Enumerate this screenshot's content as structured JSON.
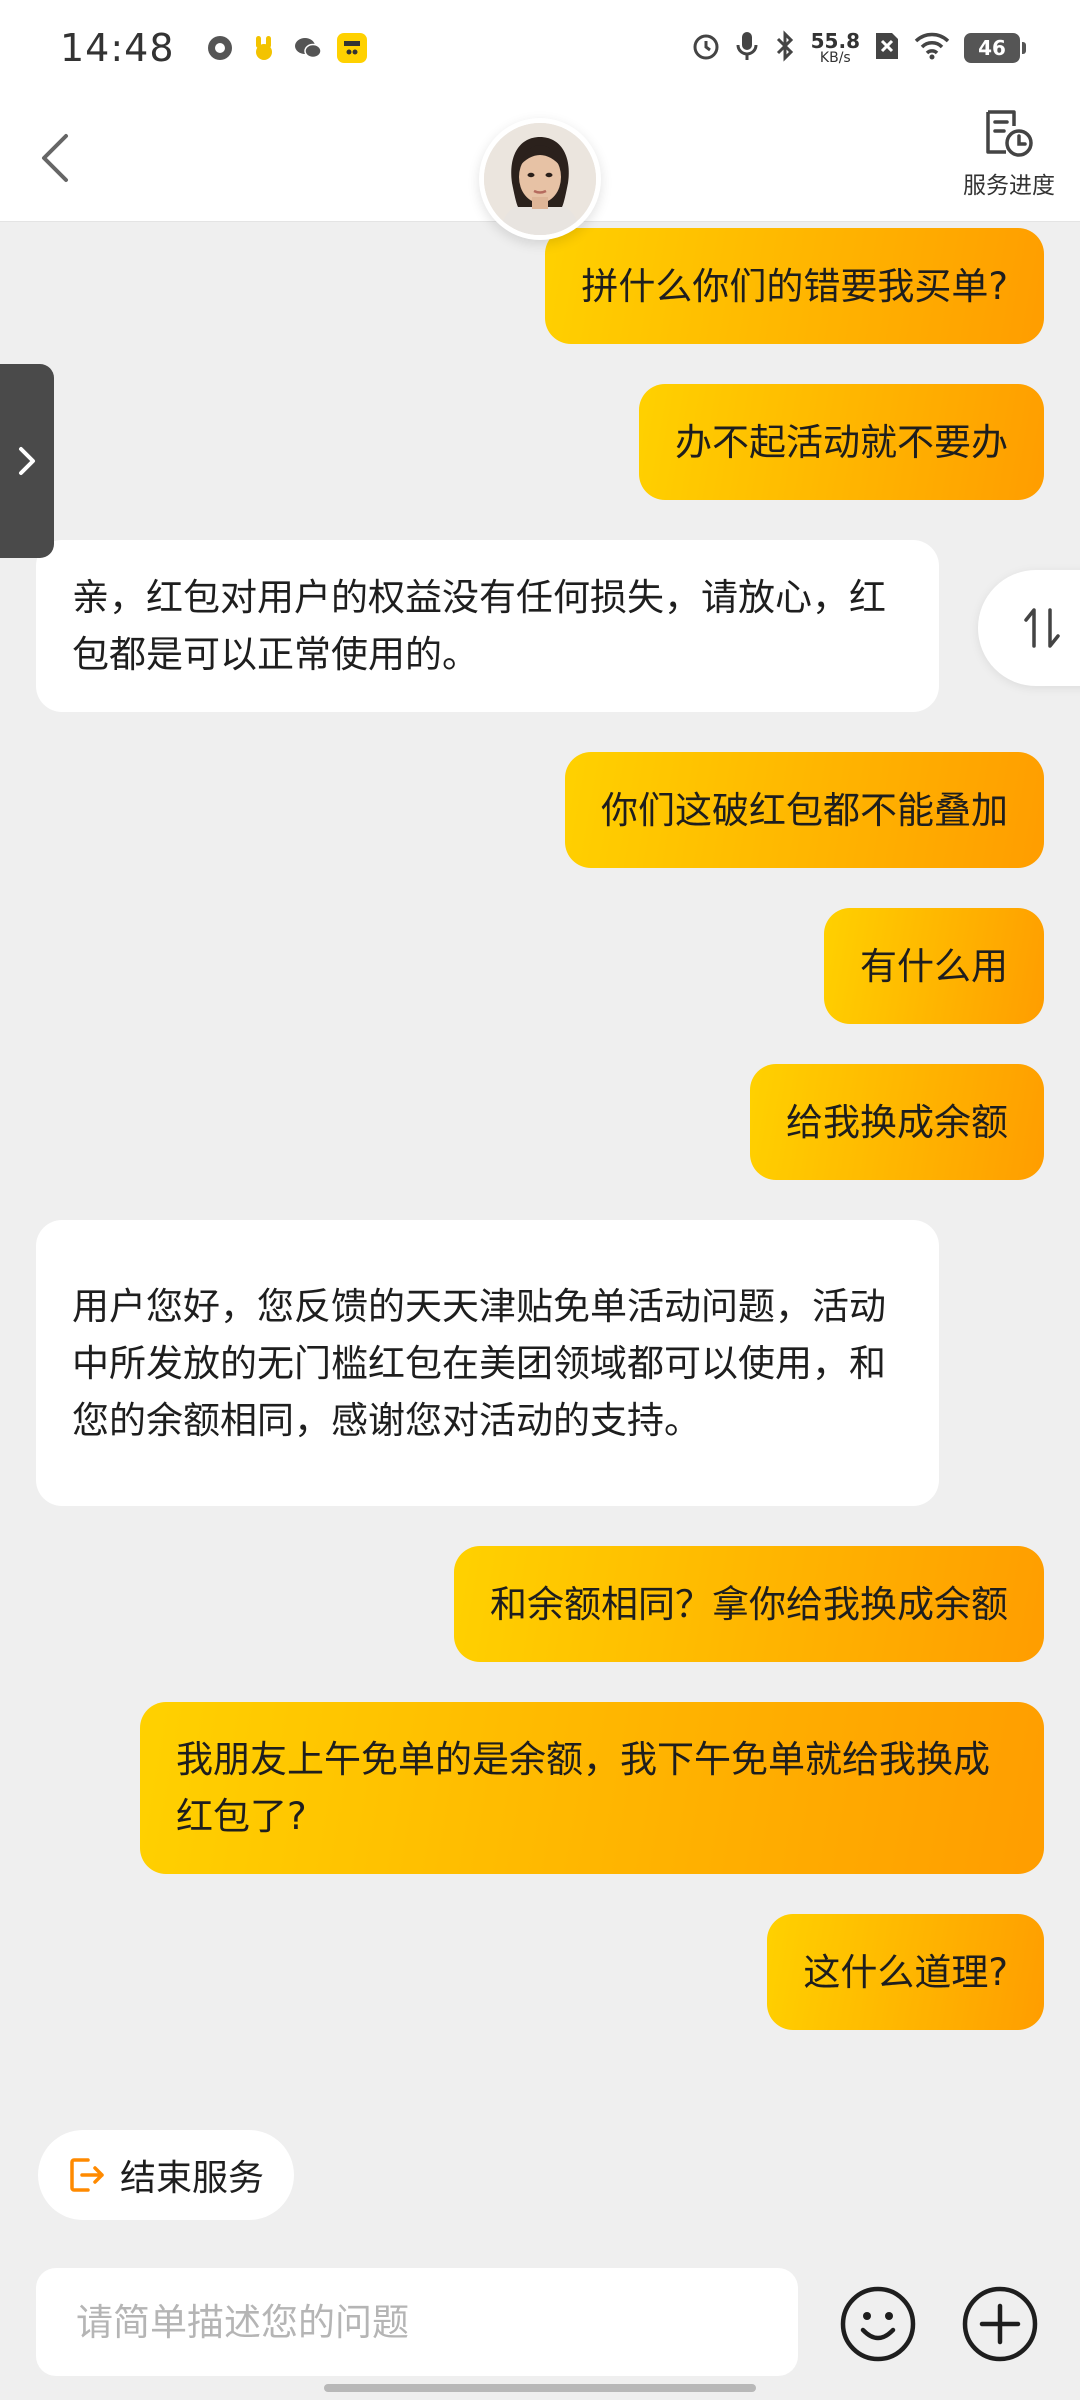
{
  "status_bar": {
    "time": "14:48",
    "net_speed_value": "55.8",
    "net_speed_unit": "KB/s",
    "battery": "46"
  },
  "header": {
    "back_icon": "chevron-left-icon",
    "progress_label": "服务进度",
    "progress_icon": "document-clock-icon"
  },
  "messages": [
    {
      "side": "right",
      "text": "拼什么你们的错要我买单?"
    },
    {
      "side": "right",
      "text": "办不起活动就不要办"
    },
    {
      "side": "left",
      "text": "亲，红包对用户的权益没有任何损失，请放心，红包都是可以正常使用的。"
    },
    {
      "side": "right",
      "text": "你们这破红包都不能叠加"
    },
    {
      "side": "right",
      "text": "有什么用"
    },
    {
      "side": "right",
      "text": "给我换成余额"
    },
    {
      "side": "left",
      "text": "用户您好，您反馈的天天津贴免单活动问题，活动中所发放的无门槛红包在美团领域都可以使用，和您的余额相同，感谢您对活动的支持。"
    },
    {
      "side": "right",
      "text": "和余额相同？拿你给我换成余额"
    },
    {
      "side": "right",
      "text": "我朋友上午免单的是余额，我下午免单就给我换成红包了?"
    },
    {
      "side": "right",
      "text": "这什么道理?"
    }
  ],
  "end_service": {
    "label": "结束服务"
  },
  "input": {
    "placeholder": "请简单描述您的问题"
  },
  "colors": {
    "bubble_gradient_start": "#ffd100",
    "bubble_gradient_end": "#ff9d00",
    "background": "#efefef",
    "end_service_icon": "#ff8a00"
  }
}
